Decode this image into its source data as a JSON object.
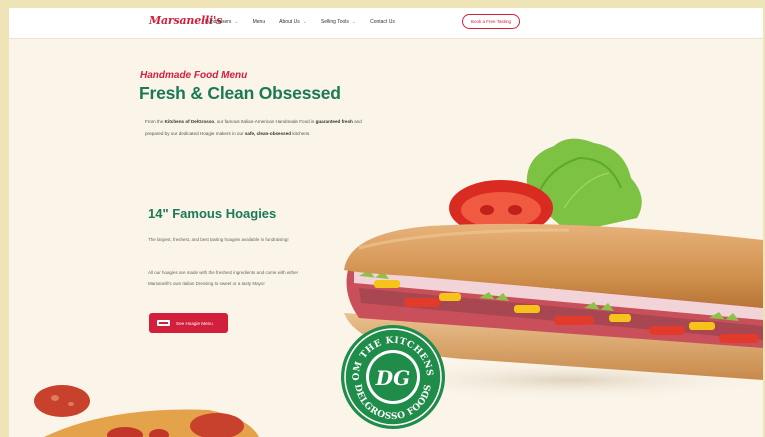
{
  "brand": {
    "logo_text": "Marsanelli's"
  },
  "nav": {
    "items": [
      {
        "label": "Fundraisers",
        "has_dropdown": true
      },
      {
        "label": "Menu",
        "has_dropdown": false
      },
      {
        "label": "About Us",
        "has_dropdown": true
      },
      {
        "label": "Selling Tools",
        "has_dropdown": true
      },
      {
        "label": "Contact Us",
        "has_dropdown": false
      }
    ],
    "cta_label": "Book a Free Tasting"
  },
  "hero": {
    "eyebrow": "Handmade Food Menu",
    "title": "Fresh & Clean Obsessed",
    "intro_1": "From the ",
    "intro_b1": "Kitchens of DelGrosso",
    "intro_2": ", our famous Italian-American Handmade Food is ",
    "intro_b2": "guaranteed fresh",
    "intro_3": " and prepared by our dedicated Hoagie makers in our ",
    "intro_b3": "safe, clean-obsessed",
    "intro_4": " kitchens."
  },
  "hoagies": {
    "title": "14\" Famous Hoagies",
    "para_1": "The largest, freshest, and best tasting hoagies available in fundraising!",
    "para_2": "All our hoagies are made with the freshest ingredients and come with either Marsanelli's own Italian Dressing to sweet or a tasty Mayo!",
    "cta_label": "See Hoagie Menu"
  },
  "badge": {
    "top_text": "FROM THE KITCHENS OF",
    "bottom_text": "DELGROSSO FOODS",
    "monogram": "DG"
  },
  "colors": {
    "brand_red": "#d21f3c",
    "brand_green": "#1b7a55",
    "page_bg": "#faf4e9",
    "outer_bg": "#efe3b8"
  },
  "icons": {
    "nav_dropdown": "chevron-down-icon",
    "hoagie_cta": "sandwich-icon"
  }
}
